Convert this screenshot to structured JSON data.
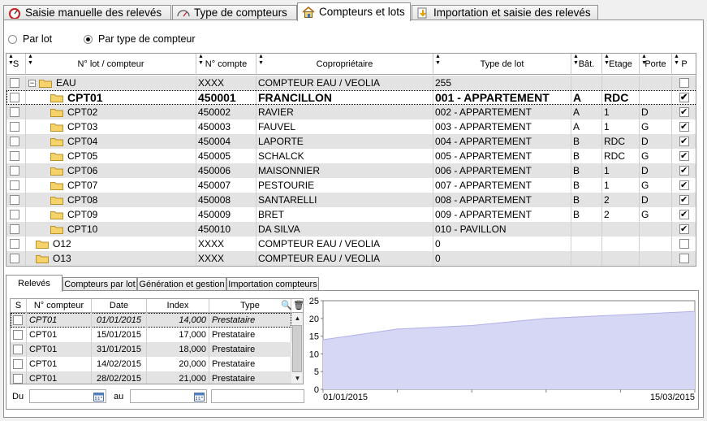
{
  "top_tabs": [
    {
      "label": "Saisie manuelle des relevés",
      "icon": "gauge-red-icon"
    },
    {
      "label": "Type de compteurs",
      "icon": "meter-icon"
    },
    {
      "label": "Compteurs et lots",
      "icon": "house-icon",
      "active": true
    },
    {
      "label": "Importation et saisie des relevés",
      "icon": "import-arrow-icon"
    }
  ],
  "mode": {
    "options": [
      "Par lot",
      "Par type de compteur"
    ],
    "selected": "Par type de compteur"
  },
  "grid": {
    "columns": [
      "S",
      "N° lot / compteur",
      "N° compte",
      "Copropriétaire",
      "Type de lot",
      "Bât.",
      "Etage",
      "Porte",
      "P"
    ],
    "rows": [
      {
        "level": 0,
        "expand": "−",
        "s": false,
        "lot": "EAU",
        "compte": "XXXX",
        "proprio": "COMPTEUR EAU / VEOLIA",
        "type": "255",
        "bat": "",
        "etage": "",
        "porte": "",
        "p": false
      },
      {
        "level": 1,
        "s": false,
        "lot": "CPT01",
        "compte": "450001",
        "proprio": "FRANCILLON",
        "type": "001 - APPARTEMENT",
        "bat": "A",
        "etage": "RDC",
        "porte": "",
        "p": true,
        "selected": true
      },
      {
        "level": 1,
        "s": false,
        "lot": "CPT02",
        "compte": "450002",
        "proprio": "RAVIER",
        "type": "002 - APPARTEMENT",
        "bat": "A",
        "etage": "1",
        "porte": "D",
        "p": true
      },
      {
        "level": 1,
        "s": false,
        "lot": "CPT03",
        "compte": "450003",
        "proprio": "FAUVEL",
        "type": "003 - APPARTEMENT",
        "bat": "A",
        "etage": "1",
        "porte": "G",
        "p": true
      },
      {
        "level": 1,
        "s": false,
        "lot": "CPT04",
        "compte": "450004",
        "proprio": "LAPORTE",
        "type": "004 - APPARTEMENT",
        "bat": "B",
        "etage": "RDC",
        "porte": "D",
        "p": true
      },
      {
        "level": 1,
        "s": false,
        "lot": "CPT05",
        "compte": "450005",
        "proprio": "SCHALCK",
        "type": "005 - APPARTEMENT",
        "bat": "B",
        "etage": "RDC",
        "porte": "G",
        "p": true
      },
      {
        "level": 1,
        "s": false,
        "lot": "CPT06",
        "compte": "450006",
        "proprio": "MAISONNIER",
        "type": "006 - APPARTEMENT",
        "bat": "B",
        "etage": "1",
        "porte": "D",
        "p": true
      },
      {
        "level": 1,
        "s": false,
        "lot": "CPT07",
        "compte": "450007",
        "proprio": "PESTOURIE",
        "type": "007 - APPARTEMENT",
        "bat": "B",
        "etage": "1",
        "porte": "G",
        "p": true
      },
      {
        "level": 1,
        "s": false,
        "lot": "CPT08",
        "compte": "450008",
        "proprio": "SANTARELLI",
        "type": "008 - APPARTEMENT",
        "bat": "B",
        "etage": "2",
        "porte": "D",
        "p": true
      },
      {
        "level": 1,
        "s": false,
        "lot": "CPT09",
        "compte": "450009",
        "proprio": "BRET",
        "type": "009 - APPARTEMENT",
        "bat": "B",
        "etage": "2",
        "porte": "G",
        "p": true
      },
      {
        "level": 1,
        "s": false,
        "lot": "CPT10",
        "compte": "450010",
        "proprio": "DA SILVA",
        "type": "010 - PAVILLON",
        "bat": "",
        "etage": "",
        "porte": "",
        "p": true
      },
      {
        "level": 0,
        "s": false,
        "lot": "O12",
        "compte": "XXXX",
        "proprio": "COMPTEUR EAU / VEOLIA",
        "type": "0",
        "bat": "",
        "etage": "",
        "porte": "",
        "p": false
      },
      {
        "level": 0,
        "s": false,
        "lot": "O13",
        "compte": "XXXX",
        "proprio": "COMPTEUR EAU / VEOLIA",
        "type": "0",
        "bat": "",
        "etage": "",
        "porte": "",
        "p": false
      }
    ]
  },
  "bottom_tabs": [
    {
      "label": "Relevés",
      "active": true
    },
    {
      "label": "Compteurs par lot"
    },
    {
      "label": "Génération et gestion"
    },
    {
      "label": "Importation compteurs"
    }
  ],
  "releves": {
    "columns": [
      "S",
      "N° compteur",
      "Date",
      "Index",
      "Type"
    ],
    "rows": [
      {
        "compteur": "CPT01",
        "date": "01/01/2015",
        "index": "14,000",
        "type": "Prestataire",
        "selected": true
      },
      {
        "compteur": "CPT01",
        "date": "15/01/2015",
        "index": "17,000",
        "type": "Prestataire"
      },
      {
        "compteur": "CPT01",
        "date": "31/01/2015",
        "index": "18,000",
        "type": "Prestataire"
      },
      {
        "compteur": "CPT01",
        "date": "14/02/2015",
        "index": "20,000",
        "type": "Prestataire"
      },
      {
        "compteur": "CPT01",
        "date": "28/02/2015",
        "index": "21,000",
        "type": "Prestataire"
      }
    ]
  },
  "filter": {
    "du_label": "Du",
    "au_label": "au",
    "du_value": "",
    "au_value": "",
    "extra_value": ""
  },
  "chart_data": {
    "type": "area",
    "x": [
      "01/01/2015",
      "15/01/2015",
      "31/01/2015",
      "14/02/2015",
      "28/02/2015",
      "15/03/2015"
    ],
    "values": [
      14,
      17,
      18,
      20,
      21,
      22
    ],
    "ylim": [
      0,
      25
    ],
    "yticks": [
      0,
      5,
      10,
      15,
      20,
      25
    ],
    "x_start_label": "01/01/2015",
    "x_end_label": "15/03/2015",
    "fill_color": "#d6d6f5",
    "line_color": "#b0b0e8",
    "grid": false
  }
}
